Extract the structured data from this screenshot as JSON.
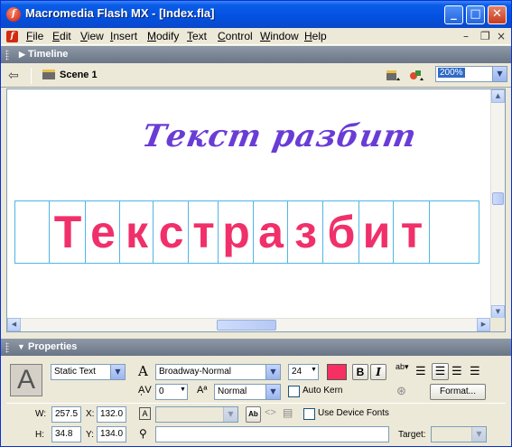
{
  "window": {
    "title": "Macromedia Flash MX - [Index.fla]"
  },
  "menu": {
    "items": [
      {
        "label": "File",
        "u": "F",
        "rest": "ile"
      },
      {
        "label": "Edit",
        "u": "E",
        "rest": "dit"
      },
      {
        "label": "View",
        "u": "V",
        "rest": "iew"
      },
      {
        "label": "Insert",
        "u": "I",
        "rest": "nsert"
      },
      {
        "label": "Modify",
        "u": "M",
        "rest": "odify"
      },
      {
        "label": "Text",
        "u": "T",
        "rest": "ext"
      },
      {
        "label": "Control",
        "u": "C",
        "rest": "ontrol"
      },
      {
        "label": "Window",
        "u": "W",
        "rest": "indow"
      },
      {
        "label": "Help",
        "u": "H",
        "rest": "elp"
      }
    ]
  },
  "timeline": {
    "title": "Timeline"
  },
  "scene": {
    "name": "Scene 1",
    "zoom": "200%"
  },
  "stage": {
    "script_text": "Текст разбит",
    "broken_letters": [
      "Т",
      "е",
      "к",
      "с",
      "т",
      "р",
      "а",
      "з",
      "б",
      "и",
      "т"
    ]
  },
  "properties": {
    "title": "Properties",
    "text_type": "Static Text",
    "font": "Broadway-Normal",
    "font_size": "24",
    "text_color": "#f73064",
    "bold": "B",
    "italic": "I",
    "char_spacing": "0",
    "baseline": "Normal",
    "auto_kern": "Auto Kern",
    "format_button": "Format...",
    "use_device_fonts": "Use Device Fonts",
    "target_label": "Target:",
    "w_label": "W:",
    "w": "257.5",
    "h_label": "H:",
    "h": "34.8",
    "x_label": "X:",
    "x": "132.0",
    "y_label": "Y:",
    "y": "134.0"
  },
  "colors": {
    "accent": "#0a5de8",
    "script_text": "#6a3cd6",
    "broken_text": "#f0306a",
    "guide_lines": "#4fb6e6"
  }
}
